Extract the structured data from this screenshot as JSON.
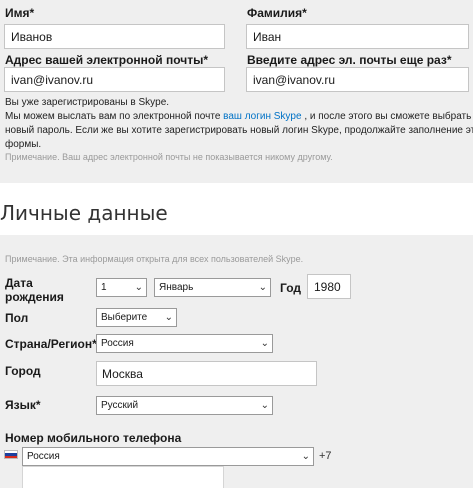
{
  "first_name": {
    "label": "Имя*",
    "value": "Иванов"
  },
  "last_name": {
    "label": "Фамилия*",
    "value": "Иван"
  },
  "email": {
    "label": "Адрес вашей электронной почты*",
    "value": "ivan@ivanov.ru"
  },
  "email_repeat": {
    "label": "Введите адрес эл. почты еще раз*",
    "value": "ivan@ivanov.ru"
  },
  "registered_notice": {
    "line1": "Вы уже зарегистрированы в Skype.",
    "line2_before": "Мы можем выслать вам по электронной почте ",
    "link": "ваш логин Skype",
    "line2_after": " , и после этого вы сможете выбрать",
    "line3": "новый пароль. Если же вы хотите зарегистрировать новый логин Skype, продолжайте заполнение этой",
    "line4": "формы."
  },
  "email_note": "Примечание. Ваш адрес электронной почты не показывается никому другому.",
  "section_title": "Личные данные",
  "personal_note": "Примечание. Эта информация открыта для всех пользователей Skype.",
  "birth": {
    "label_line1": "Дата",
    "label_line2": "рождения",
    "day": "1",
    "month": "Январь",
    "year_label": "Год",
    "year": "1980"
  },
  "gender": {
    "label": "Пол",
    "value": "Выберите"
  },
  "country": {
    "label": "Страна/Регион*",
    "value": "Россия"
  },
  "city": {
    "label": "Город",
    "value": "Москва"
  },
  "language": {
    "label": "Язык*",
    "value": "Русский"
  },
  "mobile": {
    "label": "Номер мобильного телефона",
    "country": "Россия",
    "code": "+7"
  },
  "colors": {
    "link": "#0072c6",
    "panel": "#efefef",
    "note": "#9a9a9a"
  }
}
